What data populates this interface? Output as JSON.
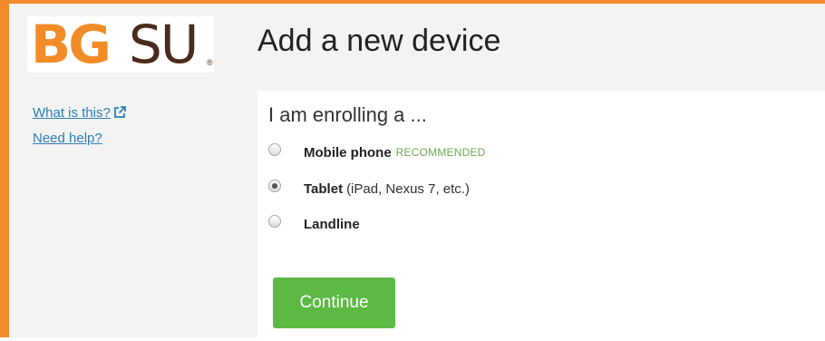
{
  "logo": {
    "text_bg": "BG",
    "text_su": "SU",
    "registered": "®"
  },
  "header": {
    "title": "Add a new device"
  },
  "sidebar": {
    "links": [
      {
        "label": "What is this?",
        "icon": "external-link-icon"
      },
      {
        "label": "Need help?"
      }
    ]
  },
  "form": {
    "heading": "I am enrolling a ...",
    "options": [
      {
        "label": "Mobile phone",
        "badge": "RECOMMENDED",
        "note": "",
        "checked": false
      },
      {
        "label": "Tablet",
        "badge": "",
        "note": "(iPad, Nexus 7, etc.)",
        "checked": true
      },
      {
        "label": "Landline",
        "badge": "",
        "note": "",
        "checked": false
      }
    ],
    "continue_label": "Continue"
  },
  "colors": {
    "accent_orange": "#f28c28",
    "logo_brown": "#4a2c1c",
    "link_blue": "#2b7fb8",
    "button_green": "#5cb944",
    "badge_green": "#6aa84f"
  }
}
